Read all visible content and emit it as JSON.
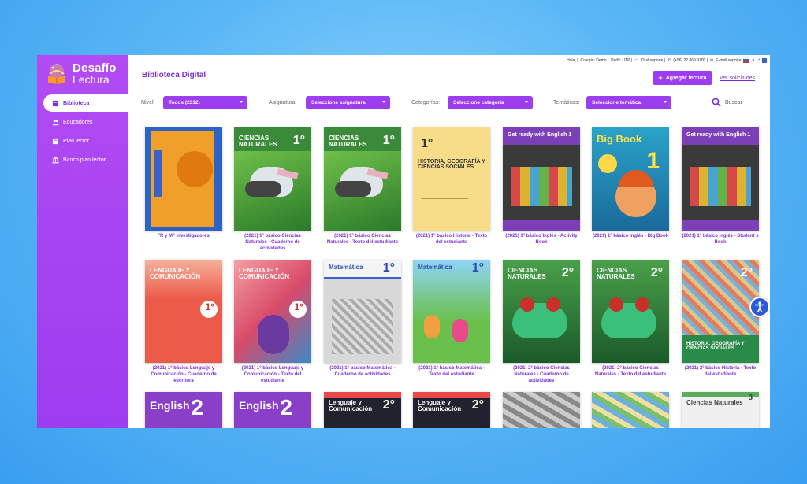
{
  "app": {
    "logo_line1": "Desafío",
    "logo_line2": "Lectura"
  },
  "topbar": {
    "greeting": "Hola, |",
    "school": "Colegio: Demo |",
    "profile": "Perfil: UTP |",
    "chat": "Chat soporte |",
    "phone": "(+56) 22 869 9100 |",
    "email": "E-mail soporte"
  },
  "sidebar": {
    "items": [
      {
        "label": "Biblioteca",
        "icon": "book-icon"
      },
      {
        "label": "Educadores",
        "icon": "users-icon"
      },
      {
        "label": "Plan lector",
        "icon": "book-open-icon"
      },
      {
        "label": "Banco plan lector",
        "icon": "bank-icon"
      }
    ]
  },
  "header": {
    "title": "Biblioteca Digital",
    "add_button": "Agregar lectura",
    "see_requests": "Ver solicitudes"
  },
  "filters": {
    "nivel_label": "Nivel:",
    "nivel_value": "Todos (2312)",
    "asignatura_label": "Asignatura:",
    "asignatura_value": "Seleccione asignatura",
    "categorias_label": "Categorías:",
    "categorias_value": "Seleccione categoría",
    "tematicas_label": "Temáticas:",
    "tematicas_value": "Seleccione temática",
    "search_label": "Buscar"
  },
  "books": [
    {
      "caption": "\"R y M\" investigadores",
      "cover_title": "",
      "num": "",
      "bg": "#2b63c6",
      "style": "rym"
    },
    {
      "caption": "(2021) 1° básico Ciencias Naturales - Cuaderno de actividades",
      "cover_title": "CIENCIAS NATURALES",
      "num": "1°",
      "bg": "#3a8a3a",
      "style": "bird"
    },
    {
      "caption": "(2021) 1° básico Ciencias Naturales - Texto del estudiante",
      "cover_title": "CIENCIAS NATURALES",
      "num": "1°",
      "bg": "#3a8a3a",
      "style": "bird"
    },
    {
      "caption": "(2021) 1° básico Historia - Texto del estudiante",
      "cover_title": "HISTORIA, GEOGRAFÍA Y CIENCIAS SOCIALES",
      "num": "1°",
      "bg": "#f7dc8a",
      "style": "historia"
    },
    {
      "caption": "(2021) 1° básico Inglés - Activity Book",
      "cover_title": "Get ready with English 1",
      "num": "",
      "bg": "#7b3fb8",
      "style": "english1"
    },
    {
      "caption": "(2021) 1° básico Inglés - Big Book",
      "cover_title": "Big Book",
      "num": "1",
      "bg": "#2aa3c9",
      "style": "bigbook"
    },
    {
      "caption": "(2021) 1° básico Inglés - Student s Book",
      "cover_title": "Get ready with English 1",
      "num": "",
      "bg": "#7b3fb8",
      "style": "english1"
    },
    {
      "caption": "(2021) 1° básico Lenguaje y Comunicación - Cuaderno de escritura",
      "cover_title": "LENGUAJE Y COMUNICACIÓN",
      "num": "1°",
      "bg": "#ec5a4a",
      "style": "lenguaje1"
    },
    {
      "caption": "(2021) 1° básico Lenguaje y Comunicación - Texto del estudiante",
      "cover_title": "LENGUAJE Y COMUNICACIÓN",
      "num": "1°",
      "bg": "#e84a6a",
      "style": "lenguaje1b"
    },
    {
      "caption": "(2021) 1° básico Matemática - Cuaderno de actividades",
      "cover_title": "Matemática",
      "num": "1°",
      "bg": "#bdbdbd",
      "style": "mate_gray"
    },
    {
      "caption": "(2021) 1° básico Matemática - Texto del estudiante",
      "cover_title": "Matemática",
      "num": "1°",
      "bg": "#7fc7e8",
      "style": "mate_color"
    },
    {
      "caption": "(2021) 2° básico Ciencias Naturales - Cuaderno de actividades",
      "cover_title": "CIENCIAS NATURALES",
      "num": "2°",
      "bg": "#2f8a3c",
      "style": "frog"
    },
    {
      "caption": "(2021) 2° básico Ciencias Naturales - Texto del estudiante",
      "cover_title": "CIENCIAS NATURALES",
      "num": "2°",
      "bg": "#2f8a3c",
      "style": "frog"
    },
    {
      "caption": "(2021) 2° básico Historia - Texto del estudiante",
      "cover_title": "HISTORIA, GEOGRAFÍA Y CIENCIAS SOCIALES",
      "num": "2°",
      "bg": "#e8e0c8",
      "style": "historia2"
    },
    {
      "caption": "",
      "cover_title": "English",
      "num": "2",
      "bg": "#8a3fc8",
      "style": "english2"
    },
    {
      "caption": "",
      "cover_title": "English",
      "num": "2",
      "bg": "#8a3fc8",
      "style": "english2"
    },
    {
      "caption": "",
      "cover_title": "Lenguaje y Comunicación",
      "num": "2°",
      "bg": "#2a2a3a",
      "style": "lenguaje2"
    },
    {
      "caption": "",
      "cover_title": "Lenguaje y Comunicación",
      "num": "2°",
      "bg": "#2a2a3a",
      "style": "lenguaje2"
    },
    {
      "caption": "",
      "cover_title": "",
      "num": "",
      "bg": "#aaaaaa",
      "style": "city_gray"
    },
    {
      "caption": "",
      "cover_title": "",
      "num": "",
      "bg": "#9ad08a",
      "style": "city_color"
    },
    {
      "caption": "",
      "cover_title": "Ciencias Naturales",
      "num": "3",
      "bg": "#5aab5a",
      "style": "ciencias3"
    }
  ],
  "colors": {
    "primary": "#9d3df0",
    "primary_dark": "#7b2fd6",
    "accessibility": "#2a5bd7"
  }
}
